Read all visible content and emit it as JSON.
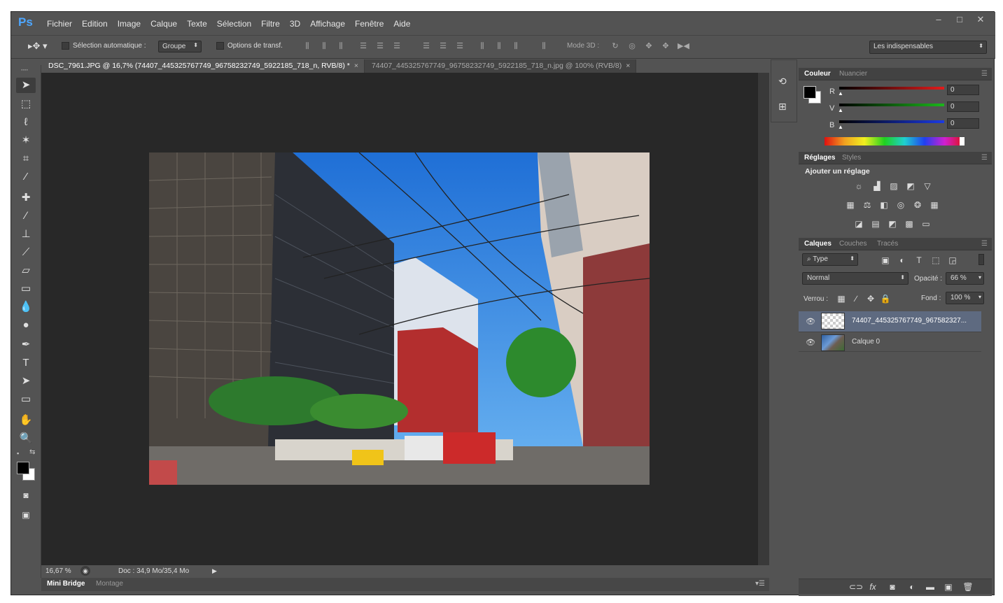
{
  "app": {
    "logo": "Ps"
  },
  "menu": [
    "Fichier",
    "Edition",
    "Image",
    "Calque",
    "Texte",
    "Sélection",
    "Filtre",
    "3D",
    "Affichage",
    "Fenêtre",
    "Aide"
  ],
  "window_controls": {
    "minimize": "–",
    "maximize": "□",
    "close": "✕"
  },
  "options": {
    "auto_select_label": "Sélection automatique :",
    "auto_select_value": "Groupe",
    "transform_label": "Options de transf.",
    "mode3d_label": "Mode 3D :",
    "workspace": "Les indispensables"
  },
  "doc_tabs": [
    {
      "label": "DSC_7961.JPG @ 16,7% (74407_445325767749_96758232749_5922185_718_n, RVB/8) *",
      "close": "×"
    },
    {
      "label": "74407_445325767749_96758232749_5922185_718_n.jpg @ 100% (RVB/8)",
      "close": "×"
    }
  ],
  "status": {
    "zoom": "16,67 %",
    "doc": "Doc : 34,9 Mo/35,4 Mo"
  },
  "bottom_tabs": [
    "Mini Bridge",
    "Montage"
  ],
  "color_panel": {
    "tabs": [
      "Couleur",
      "Nuancier"
    ],
    "channels": [
      {
        "label": "R",
        "value": "0",
        "color": "#e41b1b"
      },
      {
        "label": "V",
        "value": "0",
        "color": "#1bb71b"
      },
      {
        "label": "B",
        "value": "0",
        "color": "#1b3ae4"
      }
    ]
  },
  "adjust_panel": {
    "tabs": [
      "Réglages",
      "Styles"
    ],
    "title": "Ajouter un réglage"
  },
  "layers_panel": {
    "tabs": [
      "Calques",
      "Couches",
      "Tracés"
    ],
    "filter": "Type",
    "blend_mode": "Normal",
    "opacity_label": "Opacité :",
    "opacity": "66 %",
    "lock_label": "Verrou :",
    "fill_label": "Fond :",
    "fill": "100 %",
    "layers": [
      {
        "name": "74407_445325767749_967582327...",
        "selected": true
      },
      {
        "name": "Calque 0",
        "selected": false
      }
    ]
  }
}
